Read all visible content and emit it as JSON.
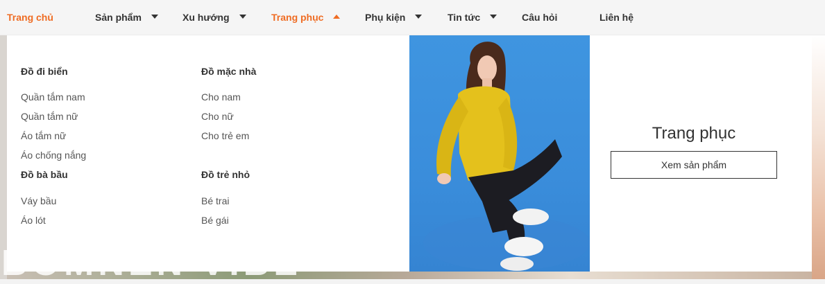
{
  "nav": {
    "items": [
      {
        "label": "Trang chủ"
      },
      {
        "label": "Sản phẩm"
      },
      {
        "label": "Xu hướng"
      },
      {
        "label": "Trang phục"
      },
      {
        "label": "Phụ kiện"
      },
      {
        "label": "Tin tức"
      },
      {
        "label": "Câu hỏi"
      },
      {
        "label": "Liên hệ"
      }
    ],
    "accent_color": "#ef6c23"
  },
  "dropdown": {
    "groups": [
      {
        "heading": "Đồ đi biển",
        "links": [
          "Quần tắm nam",
          "Quần tắm nữ",
          "Áo tắm nữ",
          "Áo chống nắng"
        ]
      },
      {
        "heading": "Đồ mặc nhà",
        "links": [
          "Cho nam",
          "Cho nữ",
          "Cho trẻ em"
        ]
      },
      {
        "heading": "Đồ bà bầu",
        "links": [
          "Váy bầu",
          "Áo lót"
        ]
      },
      {
        "heading": "Đồ trẻ nhỏ",
        "links": [
          "Bé trai",
          "Bé gái"
        ]
      }
    ],
    "promo": {
      "title": "Trang phục",
      "button_label": "Xem sản phẩm"
    }
  },
  "background": {
    "banner_text": "BOMNEN VIBE"
  }
}
